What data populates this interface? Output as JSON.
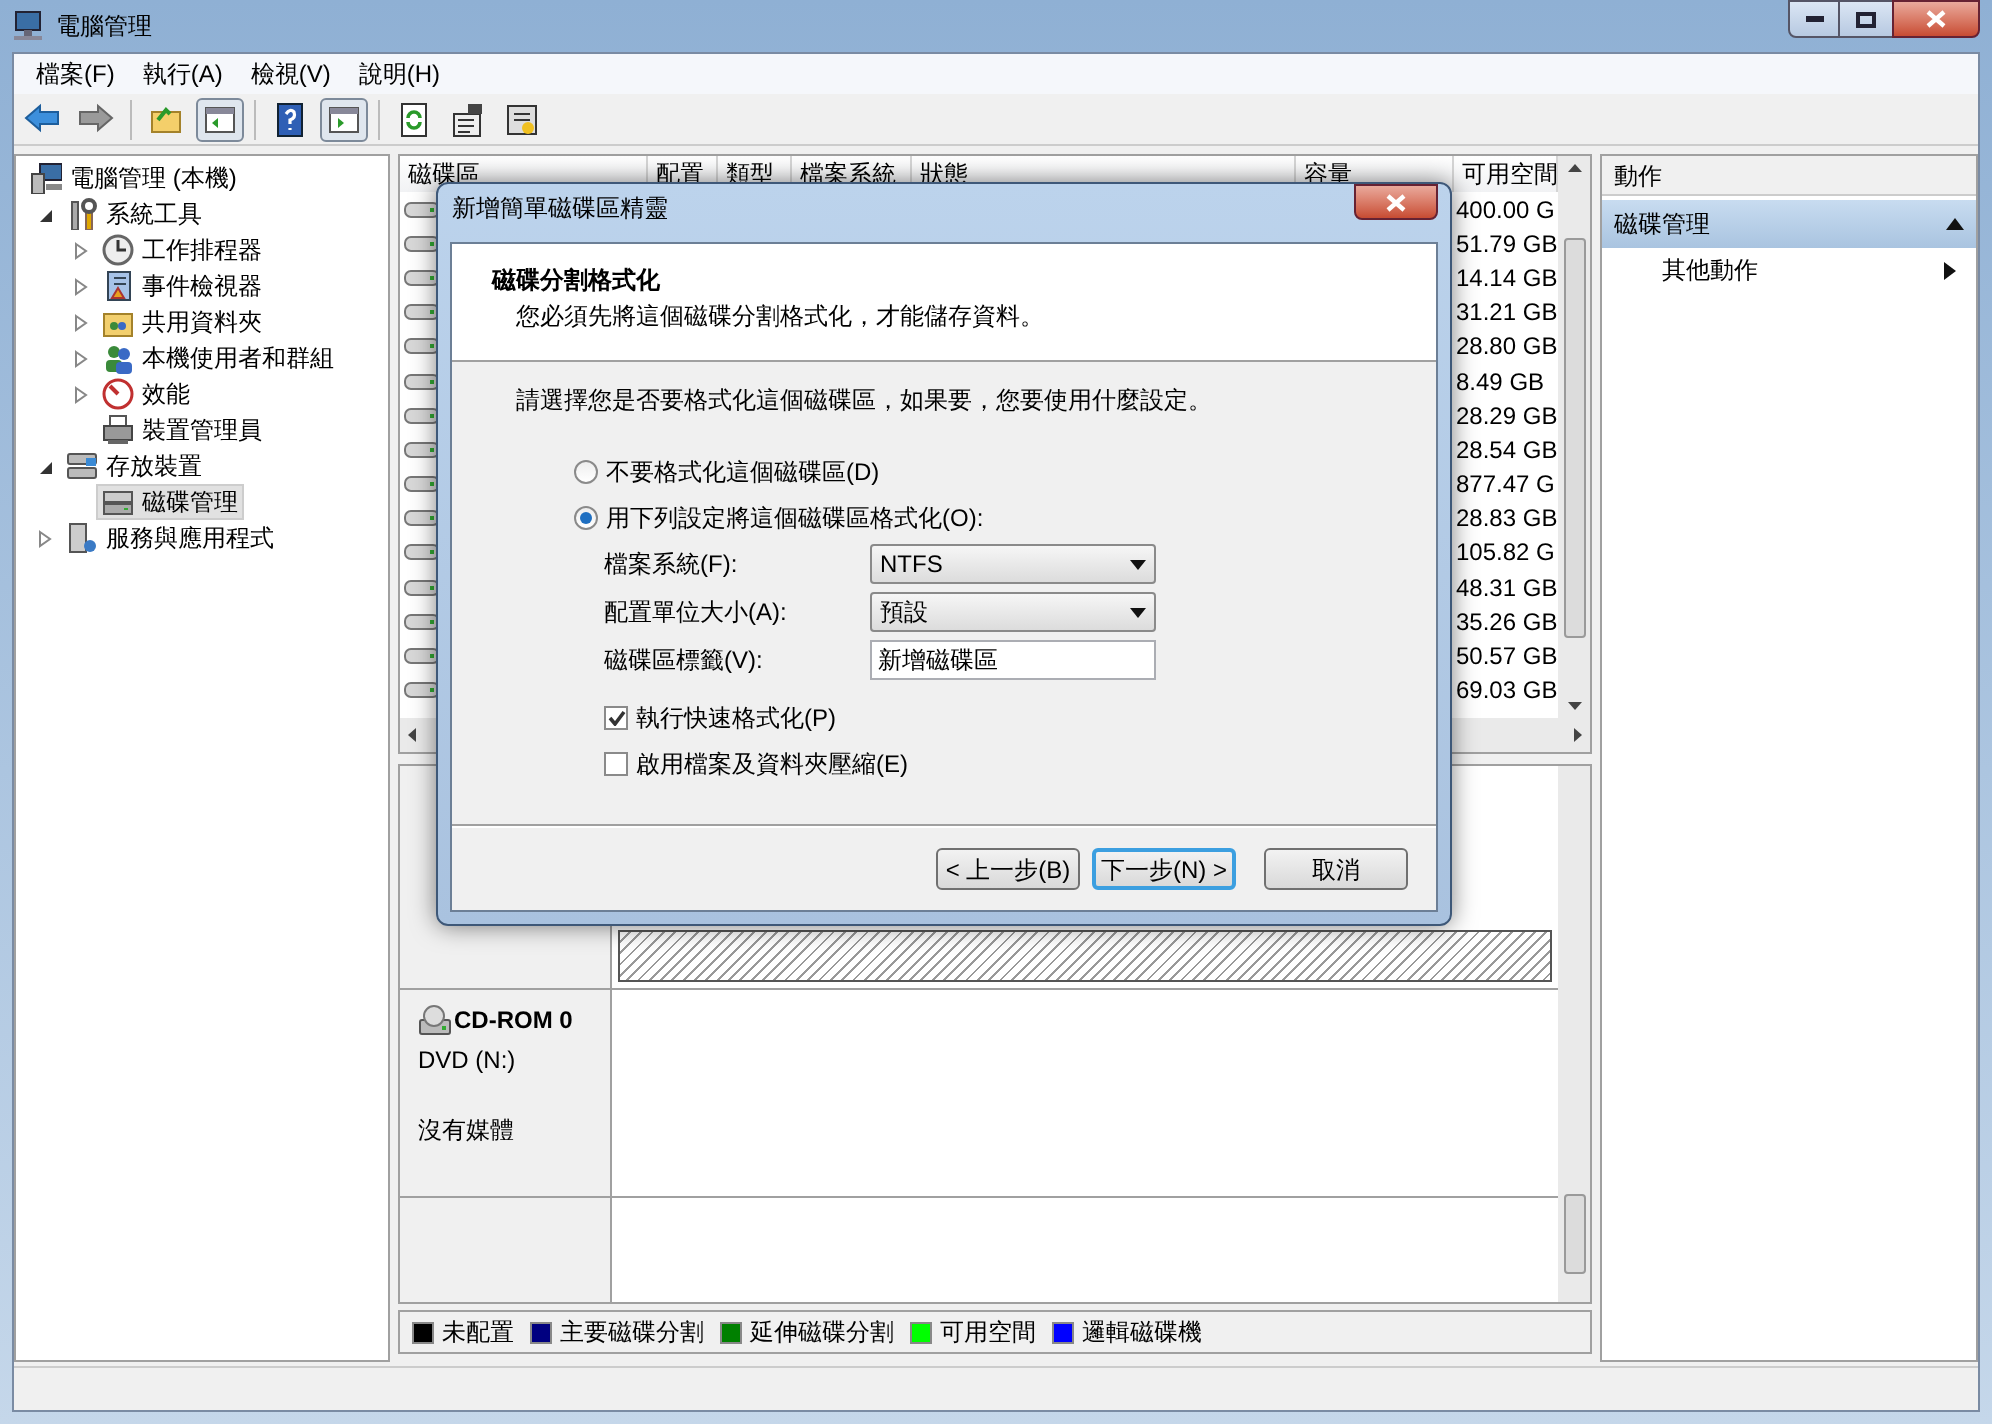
{
  "window": {
    "title": "電腦管理"
  },
  "menu": [
    "檔案(F)",
    "執行(A)",
    "檢視(V)",
    "說明(H)"
  ],
  "toolbar": [
    {
      "kind": "back",
      "pressed": false
    },
    {
      "kind": "forward",
      "pressed": false
    },
    {
      "kind": "up",
      "pressed": false
    },
    {
      "kind": "tree-toggle",
      "pressed": true
    },
    {
      "kind": "help",
      "pressed": false
    },
    {
      "kind": "action-toggle",
      "pressed": true
    },
    {
      "kind": "refresh",
      "pressed": false
    },
    {
      "kind": "properties",
      "pressed": false
    },
    {
      "kind": "disk-settings",
      "pressed": false
    }
  ],
  "tree": [
    {
      "label": "電腦管理 (本機)",
      "kind": "computer",
      "selected": false,
      "children": [
        {
          "label": "系統工具",
          "kind": "tools",
          "selected": false,
          "expanded": true,
          "children": [
            {
              "label": "工作排程器",
              "kind": "clock",
              "selected": false,
              "expanded": false
            },
            {
              "label": "事件檢視器",
              "kind": "log",
              "selected": false,
              "expanded": false
            },
            {
              "label": "共用資料夾",
              "kind": "folder",
              "selected": false,
              "expanded": false
            },
            {
              "label": "本機使用者和群組",
              "kind": "users",
              "selected": false,
              "expanded": false
            },
            {
              "label": "效能",
              "kind": "gauge",
              "selected": false,
              "expanded": false
            },
            {
              "label": "裝置管理員",
              "kind": "device",
              "selected": false
            }
          ]
        },
        {
          "label": "存放裝置",
          "kind": "storage",
          "selected": false,
          "expanded": true,
          "children": [
            {
              "label": "磁碟管理",
              "kind": "disk",
              "selected": true
            }
          ]
        },
        {
          "label": "服務與應用程式",
          "kind": "services",
          "selected": false,
          "expanded": false
        }
      ]
    }
  ],
  "volume_list": {
    "columns": [
      "磁碟區",
      "配置",
      "類型",
      "檔案系統",
      "狀態",
      "容量",
      "可用空間"
    ],
    "free_space": [
      "400.00 G",
      "51.79 GB",
      "14.14 GB",
      "31.21 GB",
      "28.80 GB",
      "8.49 GB",
      "28.29 GB",
      "28.54 GB",
      "877.47 G",
      "28.83 GB",
      "105.82 G",
      "48.31 GB",
      "35.26 GB",
      "50.57 GB",
      "69.03 GB"
    ]
  },
  "disk_view": {
    "drive": {
      "name": "CD-ROM 0",
      "type": "DVD (N:)",
      "status": "沒有媒體"
    }
  },
  "legend": [
    {
      "label": "未配置",
      "color": "#000000"
    },
    {
      "label": "主要磁碟分割",
      "color": "#000080"
    },
    {
      "label": "延伸磁碟分割",
      "color": "#008000"
    },
    {
      "label": "可用空間",
      "color": "#00ff00"
    },
    {
      "label": "邏輯磁碟機",
      "color": "#0000ff"
    }
  ],
  "actions": {
    "header": "動作",
    "section": {
      "label": "磁碟管理",
      "expanded": true
    },
    "items": [
      "其他動作"
    ]
  },
  "dialog": {
    "title": "新增簡單磁碟區精靈",
    "heading": "磁碟分割格式化",
    "subtitle": "您必須先將這個磁碟分割格式化，才能儲存資料。",
    "prompt": "請選擇您是否要格式化這個磁碟區，如果要，您要使用什麼設定。",
    "options": [
      {
        "label": "不要格式化這個磁碟區(D)",
        "selected": false
      },
      {
        "label": "用下列設定將這個磁碟區格式化(O):",
        "selected": true
      }
    ],
    "fields": [
      {
        "label": "檔案系統(F):",
        "kind": "dropdown",
        "value": "NTFS"
      },
      {
        "label": "配置單位大小(A):",
        "kind": "dropdown",
        "value": "預設"
      },
      {
        "label": "磁碟區標籤(V):",
        "kind": "text",
        "value": "新增磁碟區"
      }
    ],
    "checkboxes": [
      {
        "label": "執行快速格式化(P)",
        "checked": true
      },
      {
        "label": "啟用檔案及資料夾壓縮(E)",
        "checked": false
      }
    ],
    "buttons": [
      {
        "label": "< 上一步(B)",
        "default": false
      },
      {
        "label": "下一步(N) >",
        "default": true
      },
      {
        "label": "取消",
        "default": false
      }
    ]
  }
}
